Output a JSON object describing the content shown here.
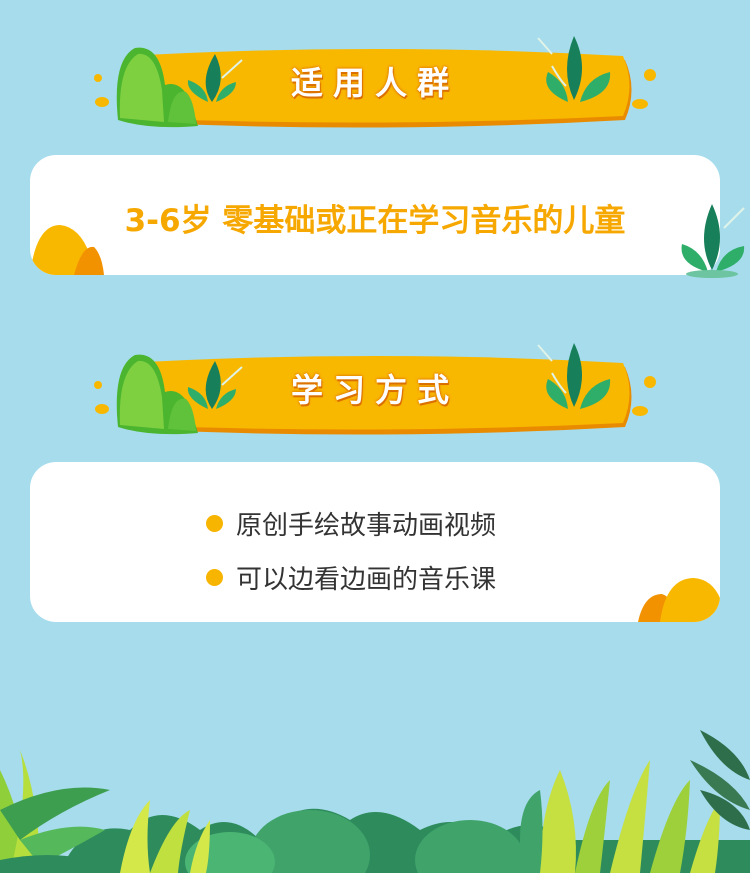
{
  "sections": {
    "audience": {
      "title": "适用人群",
      "description": "3-6岁 零基础或正在学习音乐的儿童"
    },
    "method": {
      "title": "学习方式",
      "items": [
        "原创手绘故事动画视频",
        "可以边看边画的音乐课"
      ]
    }
  },
  "colors": {
    "background": "#a6dcec",
    "banner": "#f9b800",
    "accent_text": "#f6a800",
    "card": "#ffffff",
    "bullet": "#f7b500"
  },
  "icons": [
    "leaf-icon",
    "hill-decoration",
    "plant-decoration"
  ]
}
